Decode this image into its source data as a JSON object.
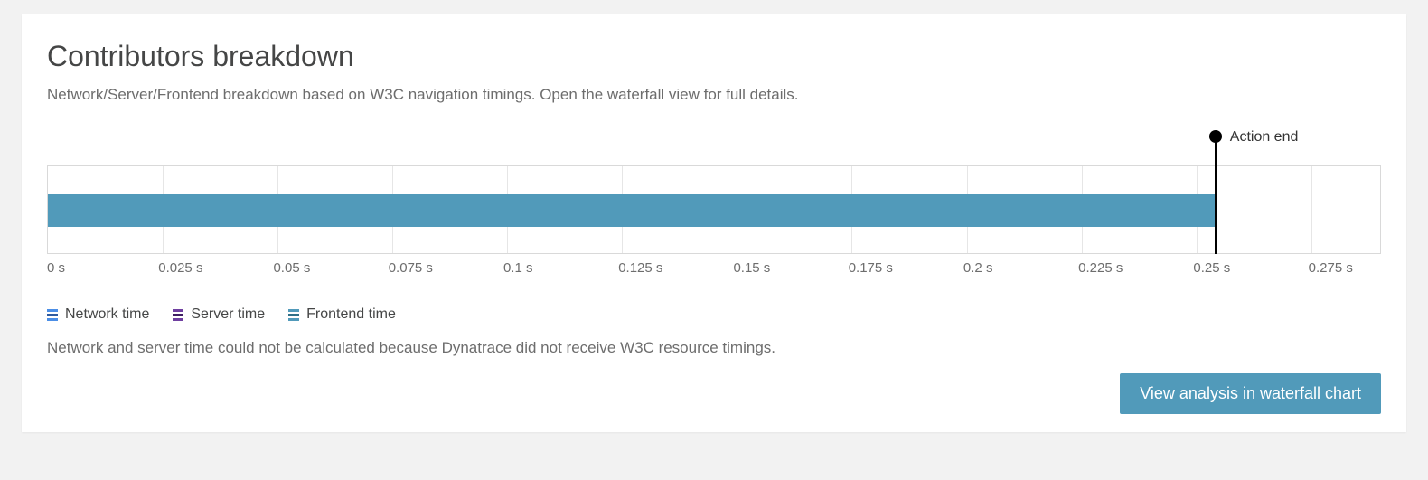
{
  "header": {
    "title": "Contributors breakdown",
    "subtitle": "Network/Server/Frontend breakdown based on W3C navigation timings. Open the waterfall view for full details."
  },
  "chart_data": {
    "type": "bar",
    "orientation": "horizontal",
    "x_unit": "s",
    "xlim": [
      0,
      0.29
    ],
    "x_ticks": [
      0,
      0.025,
      0.05,
      0.075,
      0.1,
      0.125,
      0.15,
      0.175,
      0.2,
      0.225,
      0.25,
      0.275
    ],
    "x_tick_labels": [
      "0 s",
      "0.025 s",
      "0.05 s",
      "0.075 s",
      "0.1 s",
      "0.125 s",
      "0.15 s",
      "0.175 s",
      "0.2 s",
      "0.225 s",
      "0.25 s",
      "0.275 s"
    ],
    "series": [
      {
        "name": "Network time",
        "color": "#4b8ee6",
        "start": 0,
        "end": 0
      },
      {
        "name": "Server time",
        "color": "#6f3fa0",
        "start": 0,
        "end": 0
      },
      {
        "name": "Frontend time",
        "color": "#519aba",
        "start": 0,
        "end": 0.254
      }
    ],
    "markers": [
      {
        "name": "Action end",
        "x": 0.254
      }
    ],
    "grid": true
  },
  "legend": {
    "items": [
      {
        "label": "Network time",
        "colors": [
          "#4b8ee6",
          "#2e5aa0",
          "#4b8ee6"
        ]
      },
      {
        "label": "Server time",
        "colors": [
          "#6f3fa0",
          "#3f1e63",
          "#6f3fa0"
        ]
      },
      {
        "label": "Frontend time",
        "colors": [
          "#519aba",
          "#2f6f87",
          "#519aba"
        ]
      }
    ]
  },
  "note": "Network and server time could not be calculated because Dynatrace did not receive W3C resource timings.",
  "footer": {
    "button_label": "View analysis in waterfall chart"
  }
}
